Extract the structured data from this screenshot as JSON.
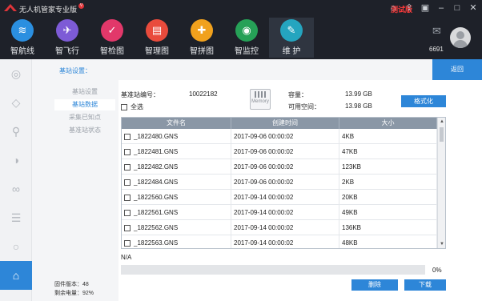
{
  "app": {
    "title": "无人机管家专业版",
    "version_dot": "V",
    "test_badge": "测试版",
    "user_id": "6691"
  },
  "colors": {
    "accent": "#2d86d8",
    "header": "#1e2129",
    "badge": "#ff3b3b"
  },
  "nav": [
    {
      "label": "智航线",
      "icon": "route-icon",
      "color": "#2b8fe0"
    },
    {
      "label": "智飞行",
      "icon": "plane-icon",
      "color": "#7d5bd6"
    },
    {
      "label": "智检图",
      "icon": "check-icon",
      "color": "#e2386a"
    },
    {
      "label": "智理图",
      "icon": "folder-icon",
      "color": "#e94b3c"
    },
    {
      "label": "智拼图",
      "icon": "puzzle-icon",
      "color": "#f1a11d"
    },
    {
      "label": "智监控",
      "icon": "monitor-icon",
      "color": "#26a157"
    },
    {
      "label": "维 护",
      "icon": "wrench-icon",
      "color": "#25a5bf",
      "active": true
    }
  ],
  "rail": [
    "globe-icon",
    "tag-icon",
    "bike-icon",
    "eye-icon",
    "drone-icon",
    "list-icon",
    "circle-icon",
    "base-station-icon"
  ],
  "section": {
    "title": "基站设置：",
    "back": "返回"
  },
  "submenu": [
    {
      "label": "基站设置",
      "active": false
    },
    {
      "label": "基站数据",
      "active": true
    },
    {
      "label": "采集已知点",
      "active": false
    },
    {
      "label": "基准站状态",
      "active": false
    }
  ],
  "firmware": {
    "version_line": "固件版本：48",
    "battery_line": "剩余电量：92%"
  },
  "station": {
    "id_label": "基准站编号：",
    "id_value": "10022182",
    "select_all": "全选",
    "memory_label": "Memory",
    "capacity_label": "容量：",
    "capacity_value": "13.99 GB",
    "free_label": "可用空间：",
    "free_value": "13.98 GB",
    "format_button": "格式化"
  },
  "table": {
    "columns": [
      "文件名",
      "创建时间",
      "大小"
    ],
    "rows": [
      [
        "_1822480.GNS",
        "2017-09-06 00:00:02",
        "4KB"
      ],
      [
        "_1822481.GNS",
        "2017-09-06 00:00:02",
        "47KB"
      ],
      [
        "_1822482.GNS",
        "2017-09-06 00:00:02",
        "123KB"
      ],
      [
        "_1822484.GNS",
        "2017-09-06 00:00:02",
        "2KB"
      ],
      [
        "_1822560.GNS",
        "2017-09-14 00:00:02",
        "20KB"
      ],
      [
        "_1822561.GNS",
        "2017-09-14 00:00:02",
        "49KB"
      ],
      [
        "_1822562.GNS",
        "2017-09-14 00:00:02",
        "136KB"
      ],
      [
        "_1822563.GNS",
        "2017-09-14 00:00:02",
        "48KB"
      ]
    ]
  },
  "status": {
    "text": "N/A",
    "progress_percent": 0,
    "progress_label": "0%"
  },
  "actions": {
    "delete": "删除",
    "download": "下载"
  }
}
